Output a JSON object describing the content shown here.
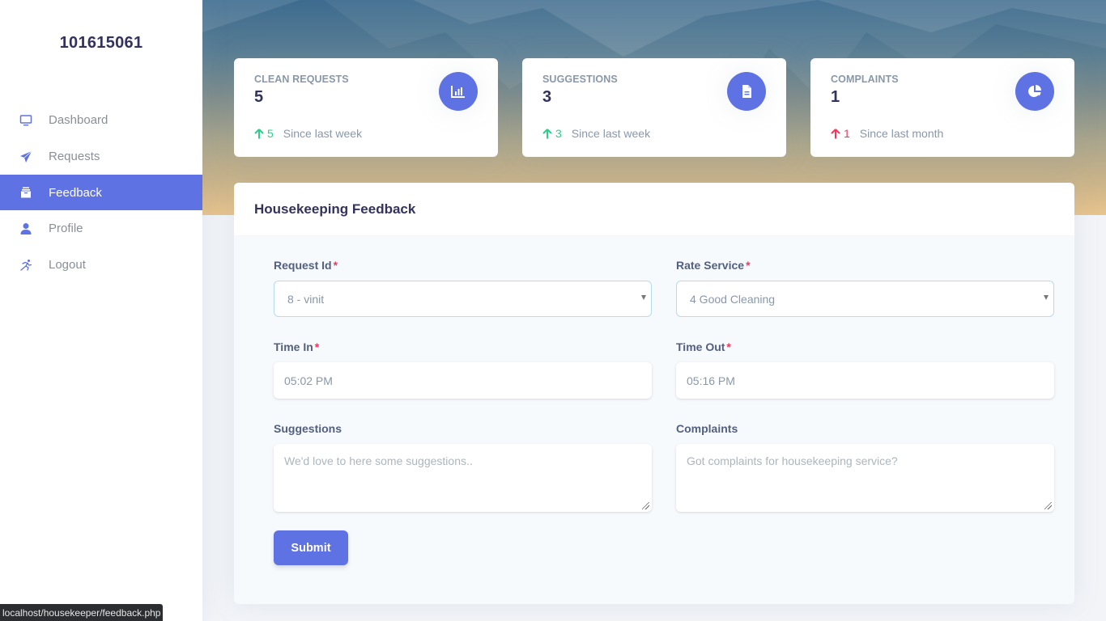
{
  "sidebar": {
    "brand": "101615061",
    "items": [
      {
        "label": "Dashboard",
        "icon": "monitor-icon",
        "active": false
      },
      {
        "label": "Requests",
        "icon": "paper-plane-icon",
        "active": false
      },
      {
        "label": "Feedback",
        "icon": "archive-box-icon",
        "active": true
      },
      {
        "label": "Profile",
        "icon": "user-icon",
        "active": false
      },
      {
        "label": "Logout",
        "icon": "running-person-icon",
        "active": false
      }
    ]
  },
  "stats": [
    {
      "title": "CLEAN REQUESTS",
      "value": "5",
      "delta": "5",
      "direction": "up",
      "period": "Since last week",
      "icon": "bar-chart-icon"
    },
    {
      "title": "SUGGESTIONS",
      "value": "3",
      "delta": "3",
      "direction": "up",
      "period": "Since last week",
      "icon": "document-icon"
    },
    {
      "title": "COMPLAINTS",
      "value": "1",
      "delta": "1",
      "direction": "up",
      "period": "Since last month",
      "icon": "pie-chart-icon"
    }
  ],
  "form": {
    "title": "Housekeeping Feedback",
    "request_id": {
      "label": "Request Id",
      "required_mark": "*",
      "value": "8 - vinit"
    },
    "rate_service": {
      "label": "Rate Service",
      "required_mark": "*",
      "value": "4 Good Cleaning"
    },
    "time_in": {
      "label": "Time In",
      "required_mark": "*",
      "value": "05:02 PM"
    },
    "time_out": {
      "label": "Time Out",
      "required_mark": "*",
      "value": "05:16 PM"
    },
    "suggestions": {
      "label": "Suggestions",
      "placeholder": "We'd love to here some suggestions.."
    },
    "complaints": {
      "label": "Complaints",
      "placeholder": "Got complaints for housekeeping service?"
    },
    "submit_label": "Submit"
  },
  "colors": {
    "primary": "#5e72e4",
    "success": "#2dce89",
    "danger": "#f5365c",
    "heading": "#32325d",
    "muted": "#8898aa"
  },
  "statusbar": {
    "url": "localhost/housekeeper/feedback.php"
  }
}
